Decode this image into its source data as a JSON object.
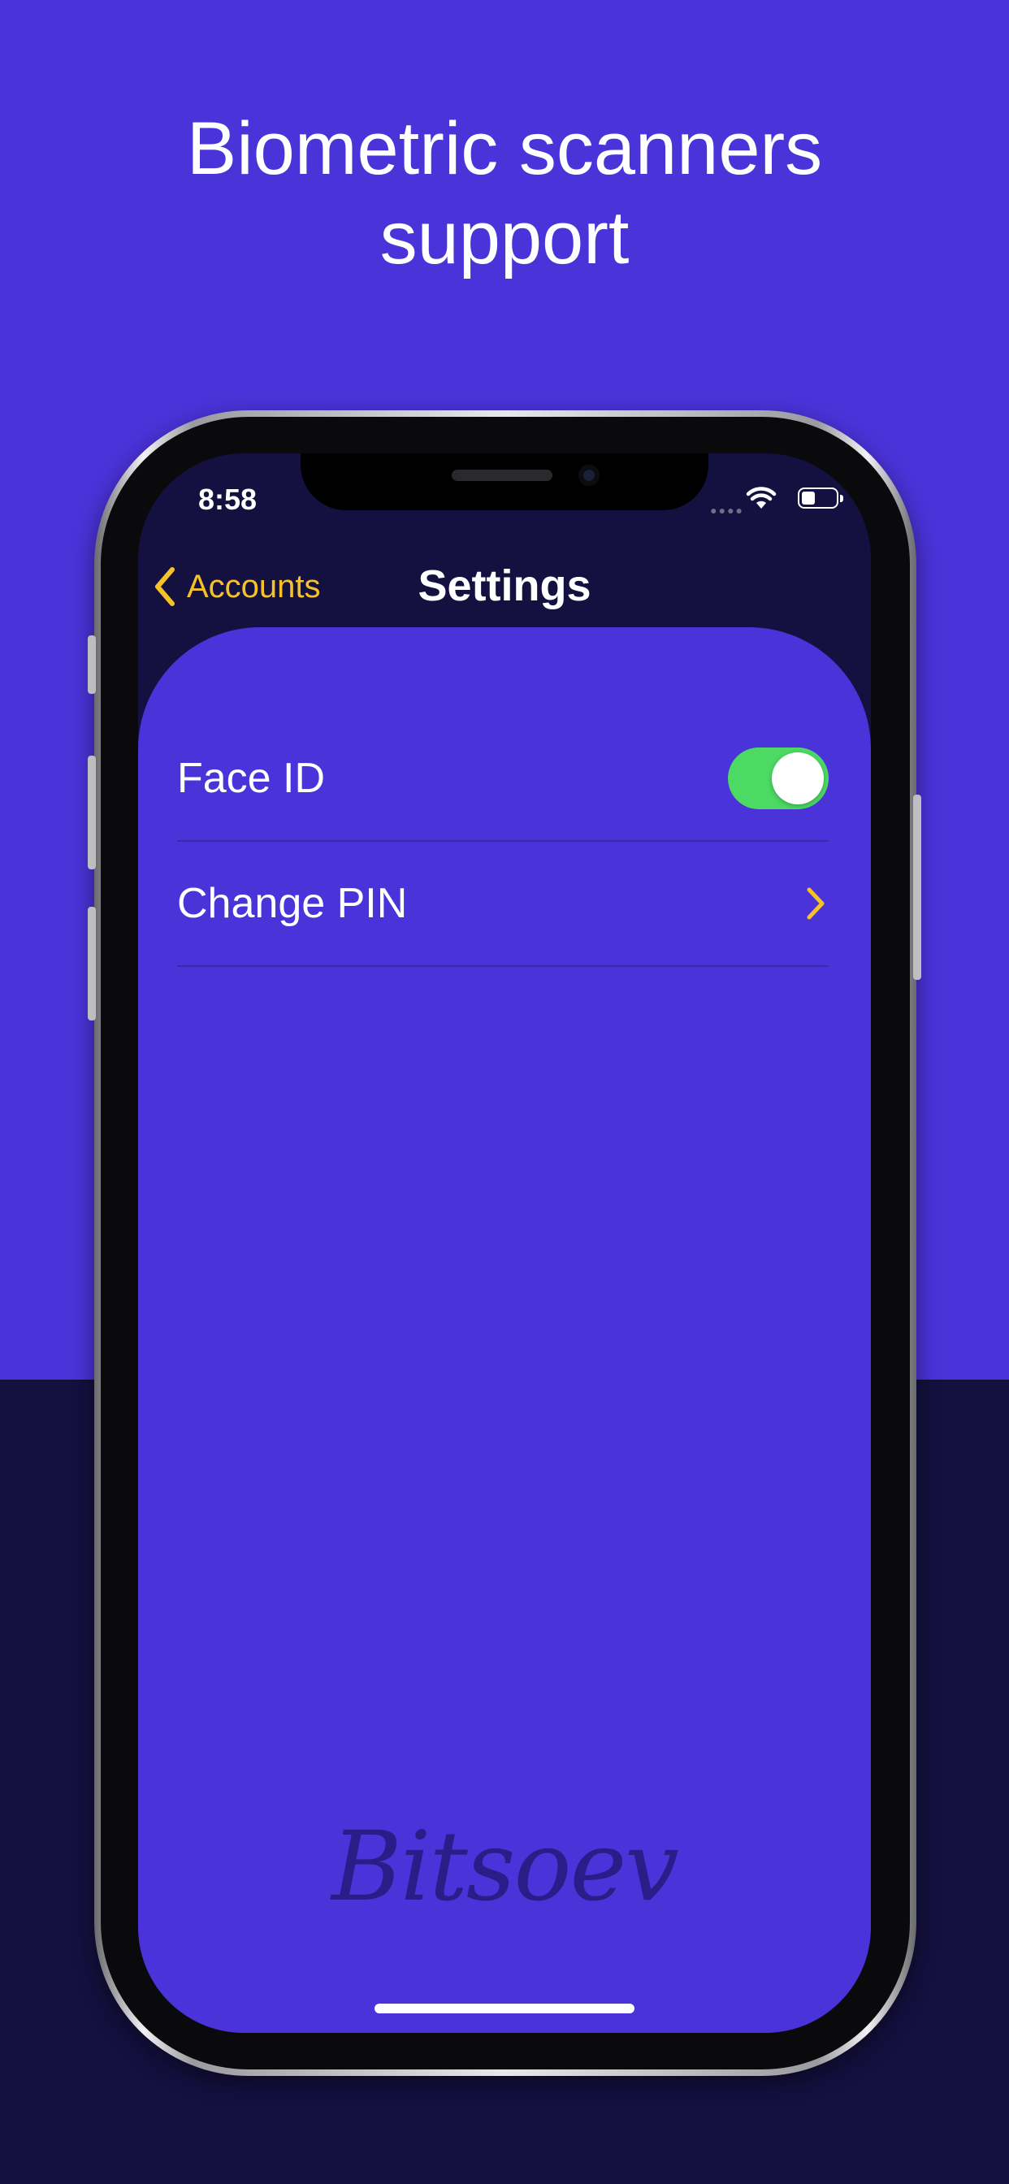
{
  "headline": {
    "line1": "Biometric scanners",
    "line2": "support"
  },
  "status_bar": {
    "time": "8:58",
    "icons": [
      "signal-dots-icon",
      "wifi-icon",
      "battery-icon"
    ]
  },
  "nav": {
    "back_label": "Accounts",
    "title": "Settings"
  },
  "settings": [
    {
      "label": "Face ID",
      "control": "toggle",
      "on": true
    },
    {
      "label": "Change PIN",
      "control": "chevron"
    }
  ],
  "brand": "Bitsoev",
  "colors": {
    "background": "#4b33da",
    "dark_band": "#141040",
    "accent": "#f5c227",
    "toggle_on": "#4cd964"
  }
}
